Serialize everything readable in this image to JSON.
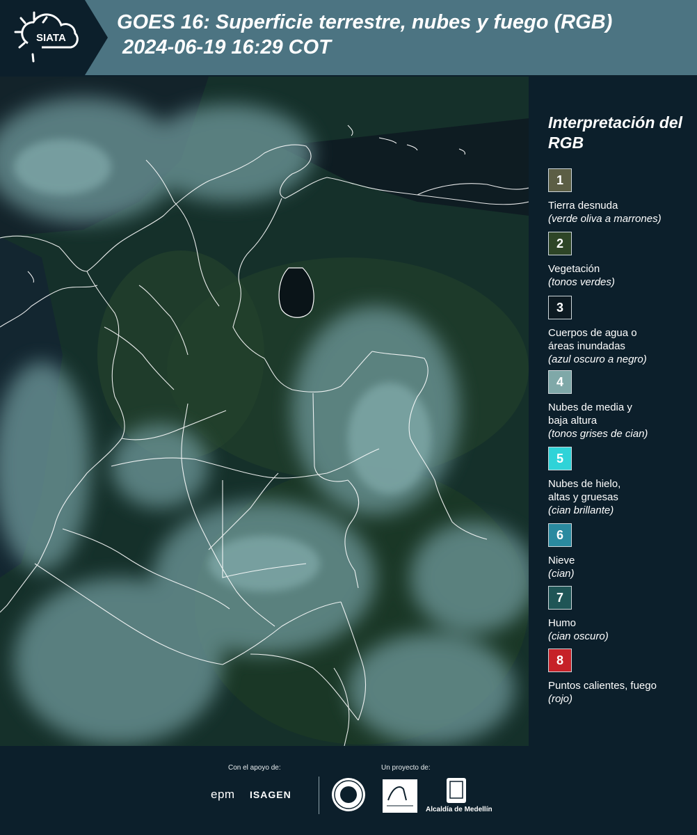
{
  "header": {
    "logo_text": "SIATA",
    "title_line1": "GOES 16: Superficie terrestre, nubes y fuego (RGB)",
    "title_line2": "2024-06-19 16:29 COT"
  },
  "map": {
    "icon": "satellite-map-colombia"
  },
  "legend": {
    "title": "Interpretación del RGB",
    "items": [
      {
        "number": "1",
        "label": "Tierra desnuda",
        "desc": "(verde oliva a marrones)",
        "color": "#5c5e45"
      },
      {
        "number": "2",
        "label": "Vegetación",
        "desc": "(tonos verdes)",
        "color": "#2e4527"
      },
      {
        "number": "3",
        "label": "Cuerpos de agua o\náreas inundadas",
        "desc": "(azul oscuro a negro)",
        "color": "#0d1a22"
      },
      {
        "number": "4",
        "label": "Nubes de media y\nbaja altura",
        "desc": "(tonos grises de cian)",
        "color": "#7fa8a8"
      },
      {
        "number": "5",
        "label": "Nubes de hielo,\naltas y gruesas",
        "desc": "(cian brillante)",
        "color": "#2fd3d8"
      },
      {
        "number": "6",
        "label": "Nieve",
        "desc": "(cian)",
        "color": "#2a8aa0"
      },
      {
        "number": "7",
        "label": "Humo",
        "desc": "(cian oscuro)",
        "color": "#1f5556"
      },
      {
        "number": "8",
        "label": "Puntos calientes, fuego",
        "desc": "(rojo)",
        "color": "#c62128"
      }
    ]
  },
  "footer": {
    "support_label": "Con el apoyo de:",
    "project_label": "Un proyecto de:",
    "epm": "epm",
    "isagen": "ISAGEN",
    "alcaldia": "Alcaldía de Medellín"
  }
}
